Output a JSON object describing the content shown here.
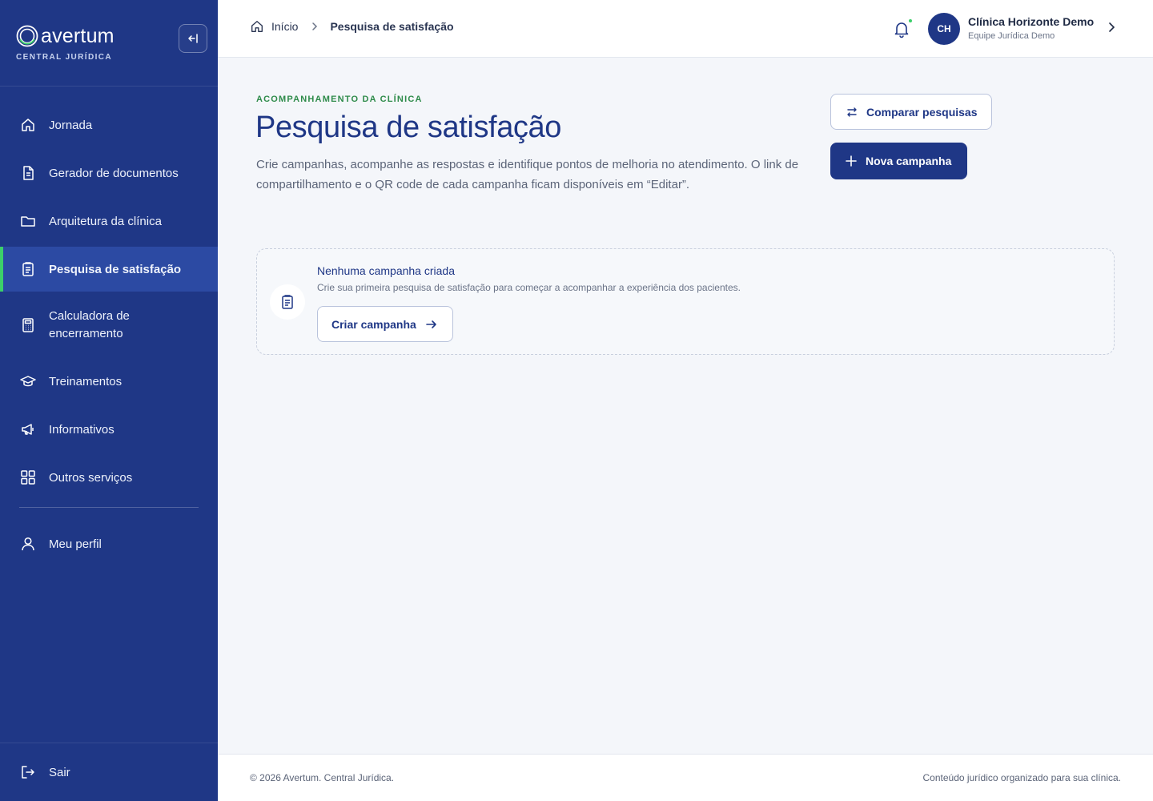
{
  "brand": {
    "name": "avertum",
    "subtitle": "CENTRAL JURÍDICA"
  },
  "sidebar": {
    "items": [
      {
        "label": "Jornada",
        "icon": "home-icon"
      },
      {
        "label": "Gerador de documentos",
        "icon": "document-icon"
      },
      {
        "label": "Arquitetura da clínica",
        "icon": "folder-icon"
      },
      {
        "label": "Pesquisa de satisfação",
        "icon": "survey-icon",
        "active": true
      },
      {
        "label": "Calculadora de encerramento",
        "icon": "calculator-icon"
      },
      {
        "label": "Treinamentos",
        "icon": "graduation-cap-icon"
      },
      {
        "label": "Informativos",
        "icon": "megaphone-icon"
      },
      {
        "label": "Outros serviços",
        "icon": "grid-icon"
      }
    ],
    "profile": {
      "label": "Meu perfil",
      "icon": "user-icon"
    },
    "logout": {
      "label": "Sair",
      "icon": "logout-icon"
    }
  },
  "header": {
    "breadcrumb": {
      "home": "Início",
      "current": "Pesquisa de satisfação"
    },
    "user": {
      "initials": "CH",
      "name": "Clínica Horizonte Demo",
      "role": "Equipe Jurídica Demo"
    }
  },
  "main": {
    "eyebrow": "ACOMPANHAMENTO DA CLÍNICA",
    "title": "Pesquisa de satisfação",
    "description": "Crie campanhas, acompanhe as respostas e identifique pontos de melhoria no atendimento. O link de compartilhamento e o QR code de cada campanha ficam disponíveis em “Editar”.",
    "compare_label": "Comparar pesquisas",
    "new_campaign_label": "Nova campanha",
    "empty": {
      "title": "Nenhuma campanha criada",
      "subtitle": "Crie sua primeira pesquisa de satisfação para começar a acompanhar a experiência dos pacientes.",
      "button_label": "Criar campanha"
    }
  },
  "footer": {
    "left": "© 2026 Avertum. Central Jurídica.",
    "right": "Conteúdo jurídico organizado para sua clínica."
  },
  "colors": {
    "sidebar": "#1f3786",
    "active_item": "#2c4aa3",
    "accent_green": "#3ccf6a",
    "eyebrow": "#2e8b4a",
    "primary": "#1f3786"
  }
}
